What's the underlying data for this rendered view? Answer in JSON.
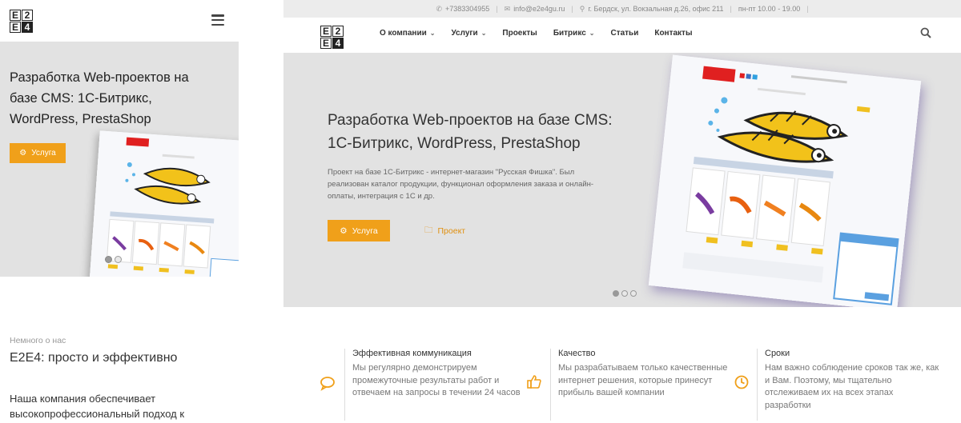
{
  "logo": {
    "tl": "E",
    "tr": "2",
    "bl": "E",
    "br": "4"
  },
  "mobile": {
    "hero_title": "Разработка Web-проектов на базе CMS: 1С-Битрикс, WordPress, PrestaShop",
    "service_button": "Услуга"
  },
  "desktop": {
    "topbar": {
      "phone": "+7383304955",
      "email": "info@e2e4gu.ru",
      "address": "г. Бердск, ул. Вокзальная д.26, офис 211",
      "hours": "пн-пт 10.00 - 19.00"
    },
    "nav": [
      {
        "label": "О компании",
        "dropdown": true
      },
      {
        "label": "Услуги",
        "dropdown": true
      },
      {
        "label": "Проекты",
        "dropdown": false
      },
      {
        "label": "Битрикс",
        "dropdown": true
      },
      {
        "label": "Статьи",
        "dropdown": false
      },
      {
        "label": "Контакты",
        "dropdown": false
      }
    ],
    "hero": {
      "title": "Разработка Web-проектов на базе CMS: 1С-Битрикс, WordPress, PrestaShop",
      "description": "Проект на базе 1С-Битрикс - интернет-магазин \"Русская Фишка\". Был реализован каталог продукции, функционал оформления заказа и онлайн-оплаты, интеграция с 1С и др.",
      "service_button": "Услуга",
      "project_button": "Проект",
      "slides_total": 3,
      "slide_active": 1
    }
  },
  "about": {
    "kicker": "Немного о нас",
    "title": "E2E4: просто и эффективно",
    "text": "Наша компания обеспечивает высокопрофессиональный подход к",
    "features": [
      {
        "icon": "chat-bubble-icon",
        "title": "Эффективная коммуникация",
        "text": "Мы регулярно демонстрируем промежуточные результаты работ и отвечаем на запросы в течении 24 часов"
      },
      {
        "icon": "thumbs-up-icon",
        "title": "Качество",
        "text": "Мы разрабатываем только качественные интернет решения, которые принесут прибыль вашей компании"
      },
      {
        "icon": "clock-icon",
        "title": "Сроки",
        "text": "Нам важно соблюдение сроков так же, как и Вам. Поэтому, мы тщательно отслеживаем их на всех этапах разработки"
      }
    ]
  },
  "colors": {
    "accent": "#f0a01a",
    "hero_bg": "#e2e2e2",
    "topbar_bg": "#ececec"
  }
}
